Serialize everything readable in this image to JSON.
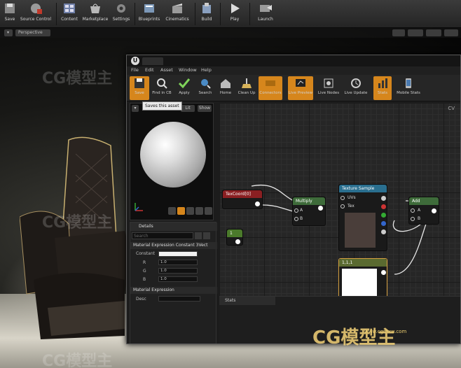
{
  "main_toolbar": {
    "buttons": [
      {
        "label": "Save",
        "icon": "save-icon"
      },
      {
        "label": "Source Control",
        "icon": "source-control-icon"
      },
      {
        "label": "Content",
        "icon": "content-icon"
      },
      {
        "label": "Marketplace",
        "icon": "marketplace-icon"
      },
      {
        "label": "Settings",
        "icon": "settings-icon"
      },
      {
        "label": "Blueprints",
        "icon": "blueprints-icon"
      },
      {
        "label": "Cinematics",
        "icon": "cinematics-icon"
      },
      {
        "label": "Build",
        "icon": "build-icon"
      },
      {
        "label": "Play",
        "icon": "play-icon"
      },
      {
        "label": "Launch",
        "icon": "launch-icon"
      }
    ]
  },
  "viewport": {
    "perspective_label": "Perspective"
  },
  "material_editor": {
    "menu": [
      "File",
      "Edit",
      "Asset",
      "Window",
      "Help"
    ],
    "toolbar": [
      {
        "label": "Save",
        "icon": "save-icon",
        "active": true
      },
      {
        "label": "Find in CB",
        "icon": "find-in-cb-icon",
        "active": false
      },
      {
        "label": "Apply",
        "icon": "apply-icon",
        "active": false
      },
      {
        "label": "Search",
        "icon": "search-icon",
        "active": false
      },
      {
        "label": "Home",
        "icon": "home-icon",
        "active": false
      },
      {
        "label": "Clean Up",
        "icon": "clean-up-icon",
        "active": false
      },
      {
        "label": "Connectors",
        "icon": "connectors-icon",
        "active": true
      },
      {
        "label": "Live Preview",
        "icon": "live-preview-icon",
        "active": true
      },
      {
        "label": "Live Nodes",
        "icon": "live-nodes-icon",
        "active": false
      },
      {
        "label": "Live Update",
        "icon": "live-update-icon",
        "active": false
      },
      {
        "label": "Stats",
        "icon": "stats-icon",
        "active": true
      },
      {
        "label": "Mobile Stats",
        "icon": "mobile-stats-icon",
        "active": false
      }
    ],
    "tooltip": "Saves this asset",
    "preview": {
      "lit_label": "Lit",
      "show_label": "Show"
    },
    "details": {
      "tab_label": "Details",
      "search_placeholder": "Search",
      "section_constant": "Material Expression Constant 3Vect",
      "constant_label": "Constant",
      "r_label": "R",
      "g_label": "G",
      "b_label": "B",
      "r_value": "1.0",
      "g_value": "1.0",
      "b_value": "1.0",
      "section_expression": "Material Expression",
      "desc_label": "Desc"
    },
    "graph": {
      "corner_label": "CV",
      "nodes": {
        "texcoord": {
          "title": "TexCoord[0]"
        },
        "constant1": {
          "title": "1"
        },
        "multiply": {
          "title": "Multiply",
          "pin_a": "A",
          "pin_b": "B"
        },
        "texture_sample": {
          "title": "Texture Sample",
          "pin_uvs": "UVs",
          "pin_tex": "Tex"
        },
        "constant3": {
          "title": "1,1,1"
        },
        "add": {
          "title": "Add",
          "pin_a": "A",
          "pin_b": "B"
        }
      }
    },
    "stats": {
      "tab_label": "Stats"
    }
  },
  "watermarks": {
    "brand": "CG模型主",
    "site": "www.cgmxw.com",
    "url_overlay": "WWW.CGMXW.COM"
  },
  "colors": {
    "accent_orange": "#d6861c",
    "texcoord_header": "#8a1f22",
    "constant_header": "#4b7a2b",
    "multiply_header": "#3e6b3a",
    "texture_header": "#2a6f8f",
    "add_header": "#3e6b3a"
  }
}
